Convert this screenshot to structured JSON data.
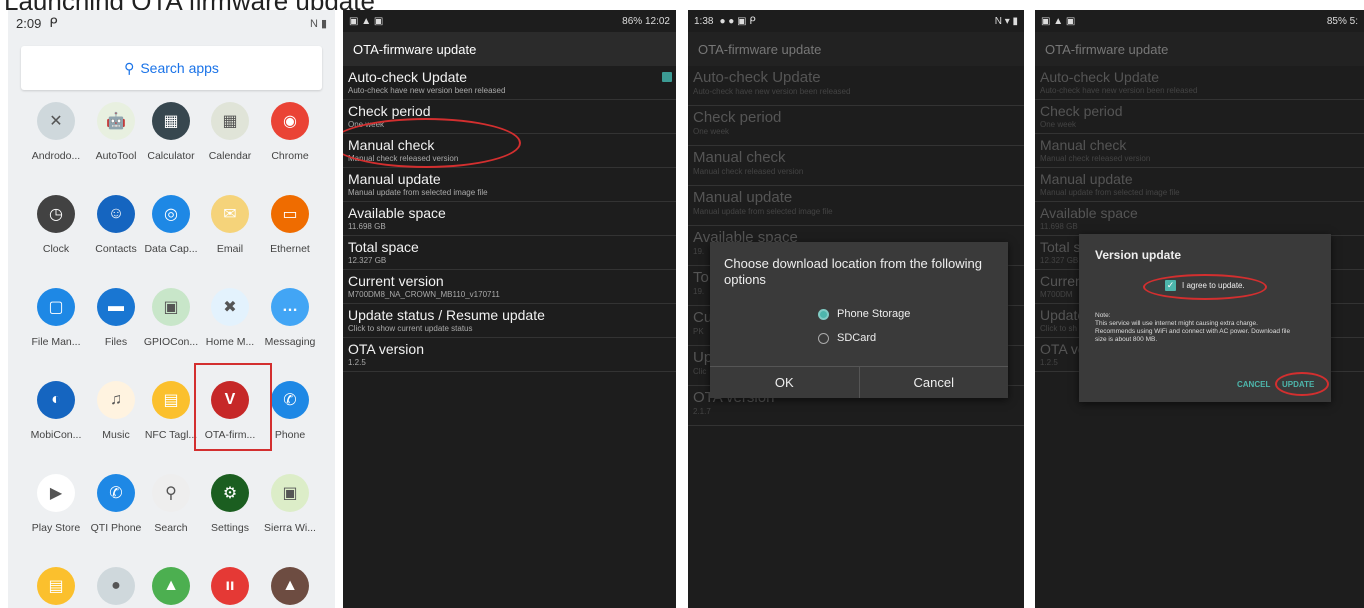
{
  "caption": "Launching OTA firmware update",
  "panel1": {
    "status_time": "2:09",
    "search_label": "Search apps",
    "apps": [
      {
        "label": "Androdo...",
        "icon": "wrench-icon",
        "color": "#cfd8dc",
        "glyph": "✕"
      },
      {
        "label": "AutoTool",
        "icon": "android-icon",
        "color": "#e8f0e0",
        "glyph": "🤖"
      },
      {
        "label": "Calculator",
        "icon": "calculator-icon",
        "color": "#37474f",
        "glyph": "▦"
      },
      {
        "label": "Calendar",
        "icon": "calendar-icon",
        "color": "#e0e4d8",
        "glyph": "▦"
      },
      {
        "label": "Chrome",
        "icon": "chrome-icon",
        "color": "#ea4335",
        "glyph": "◉"
      },
      {
        "label": "Clock",
        "icon": "clock-icon",
        "color": "#424242",
        "glyph": "◷"
      },
      {
        "label": "Contacts",
        "icon": "contacts-icon",
        "color": "#1565c0",
        "glyph": "☺"
      },
      {
        "label": "Data Cap...",
        "icon": "datacap-icon",
        "color": "#1e88e5",
        "glyph": "◎"
      },
      {
        "label": "Email",
        "icon": "email-icon",
        "color": "#f5d37a",
        "glyph": "✉"
      },
      {
        "label": "Ethernet",
        "icon": "ethernet-icon",
        "color": "#ef6c00",
        "glyph": "▭"
      },
      {
        "label": "File Man...",
        "icon": "file-manager-icon",
        "color": "#1e88e5",
        "glyph": "▢"
      },
      {
        "label": "Files",
        "icon": "files-icon",
        "color": "#1976d2",
        "glyph": "▬"
      },
      {
        "label": "GPIOCon...",
        "icon": "gpio-icon",
        "color": "#c8e6c9",
        "glyph": "▣"
      },
      {
        "label": "Home M...",
        "icon": "home-manager-icon",
        "color": "#e3f2fd",
        "glyph": "✖"
      },
      {
        "label": "Messaging",
        "icon": "messaging-icon",
        "color": "#42a5f5",
        "glyph": "…"
      },
      {
        "label": "MobiCon...",
        "icon": "mobicontrol-icon",
        "color": "#1565c0",
        "glyph": "◐"
      },
      {
        "label": "Music",
        "icon": "music-icon",
        "color": "#fff3e0",
        "glyph": "♫"
      },
      {
        "label": "NFC Tagl...",
        "icon": "nfc-icon",
        "color": "#fbc02d",
        "glyph": "▤"
      },
      {
        "label": "OTA-firm...",
        "icon": "ota-firmware-icon",
        "color": "#c62828",
        "glyph": "V"
      },
      {
        "label": "Phone",
        "icon": "phone-icon",
        "color": "#1e88e5",
        "glyph": "✆"
      },
      {
        "label": "Play Store",
        "icon": "play-store-icon",
        "color": "#ffffff",
        "glyph": "▶"
      },
      {
        "label": "QTI Phone",
        "icon": "qti-phone-icon",
        "color": "#1e88e5",
        "glyph": "✆"
      },
      {
        "label": "Search",
        "icon": "search-icon",
        "color": "#eeeeee",
        "glyph": "⚲"
      },
      {
        "label": "Settings",
        "icon": "settings-icon",
        "color": "#1b5e20",
        "glyph": "⚙"
      },
      {
        "label": "Sierra Wi...",
        "icon": "sierra-icon",
        "color": "#dcedc8",
        "glyph": "▣"
      },
      {
        "label": "",
        "icon": "file-icon",
        "color": "#fbc02d",
        "glyph": "▤"
      },
      {
        "label": "",
        "icon": "camera-icon",
        "color": "#cfd8dc",
        "glyph": "●"
      },
      {
        "label": "",
        "icon": "gallery-icon",
        "color": "#4caf50",
        "glyph": "▲"
      },
      {
        "label": "",
        "icon": "audio-icon",
        "color": "#e53935",
        "glyph": "ıı"
      },
      {
        "label": "",
        "icon": "hat-icon",
        "color": "#6d4c41",
        "glyph": "▲"
      }
    ]
  },
  "panel2": {
    "status_right": "86% 12:02",
    "title": "OTA-firmware update",
    "prefs": [
      {
        "title": "Auto-check Update",
        "sub": "Auto-check have new version been released",
        "check": true
      },
      {
        "title": "Check period",
        "sub": "One week"
      },
      {
        "title": "Manual check",
        "sub": "Manual check released version"
      },
      {
        "title": "Manual update",
        "sub": "Manual update from selected image file"
      },
      {
        "title": "Available space",
        "sub": "11.698 GB"
      },
      {
        "title": "Total space",
        "sub": "12.327 GB"
      },
      {
        "title": "Current version",
        "sub": "M700DM8_NA_CROWN_MB110_v170711"
      },
      {
        "title": "Update status / Resume update",
        "sub": "Click to show current update status"
      },
      {
        "title": "OTA version",
        "sub": "1.2.5"
      }
    ]
  },
  "panel3": {
    "status_time": "1:38",
    "title": "OTA-firmware update",
    "prefs": [
      {
        "title": "Auto-check Update",
        "sub": "Auto-check have new version been released"
      },
      {
        "title": "Check period",
        "sub": "One week"
      },
      {
        "title": "Manual check",
        "sub": "Manual check released version"
      },
      {
        "title": "Manual update",
        "sub": "Manual update from selected image file"
      },
      {
        "title": "Available space",
        "sub": "19."
      },
      {
        "title": "To",
        "sub": "19."
      },
      {
        "title": "Cu",
        "sub": "PK"
      },
      {
        "title": "Up",
        "sub": "Clic"
      },
      {
        "title": "OTA version",
        "sub": "2.1.7"
      }
    ],
    "dialog": {
      "heading": "Choose download location from the following options",
      "opt1": "Phone Storage",
      "opt2": "SDCard",
      "ok": "OK",
      "cancel": "Cancel"
    }
  },
  "panel4": {
    "status_right": "85% 5:",
    "title": "OTA-firmware update",
    "prefs": [
      {
        "title": "Auto-check Update",
        "sub": "Auto-check have new version been released"
      },
      {
        "title": "Check period",
        "sub": "One week"
      },
      {
        "title": "Manual check",
        "sub": "Manual check released version"
      },
      {
        "title": "Manual update",
        "sub": "Manual update from selected image file"
      },
      {
        "title": "Available space",
        "sub": "11.698 GB"
      },
      {
        "title": "Total s",
        "sub": "12.327 GB"
      },
      {
        "title": "Curren",
        "sub": "M700DM"
      },
      {
        "title": "Update",
        "sub": "Click to sh"
      },
      {
        "title": "OTA ve",
        "sub": "1.2.5"
      }
    ],
    "dialog": {
      "heading": "Version update",
      "agree": "I agree to update.",
      "note_label": "Note:",
      "note": "This service will use internet might causing extra charge. Recommends using WiFi and connect with AC power. Download file size is about 800 MB.",
      "cancel": "CANCEL",
      "update": "UPDATE"
    }
  }
}
